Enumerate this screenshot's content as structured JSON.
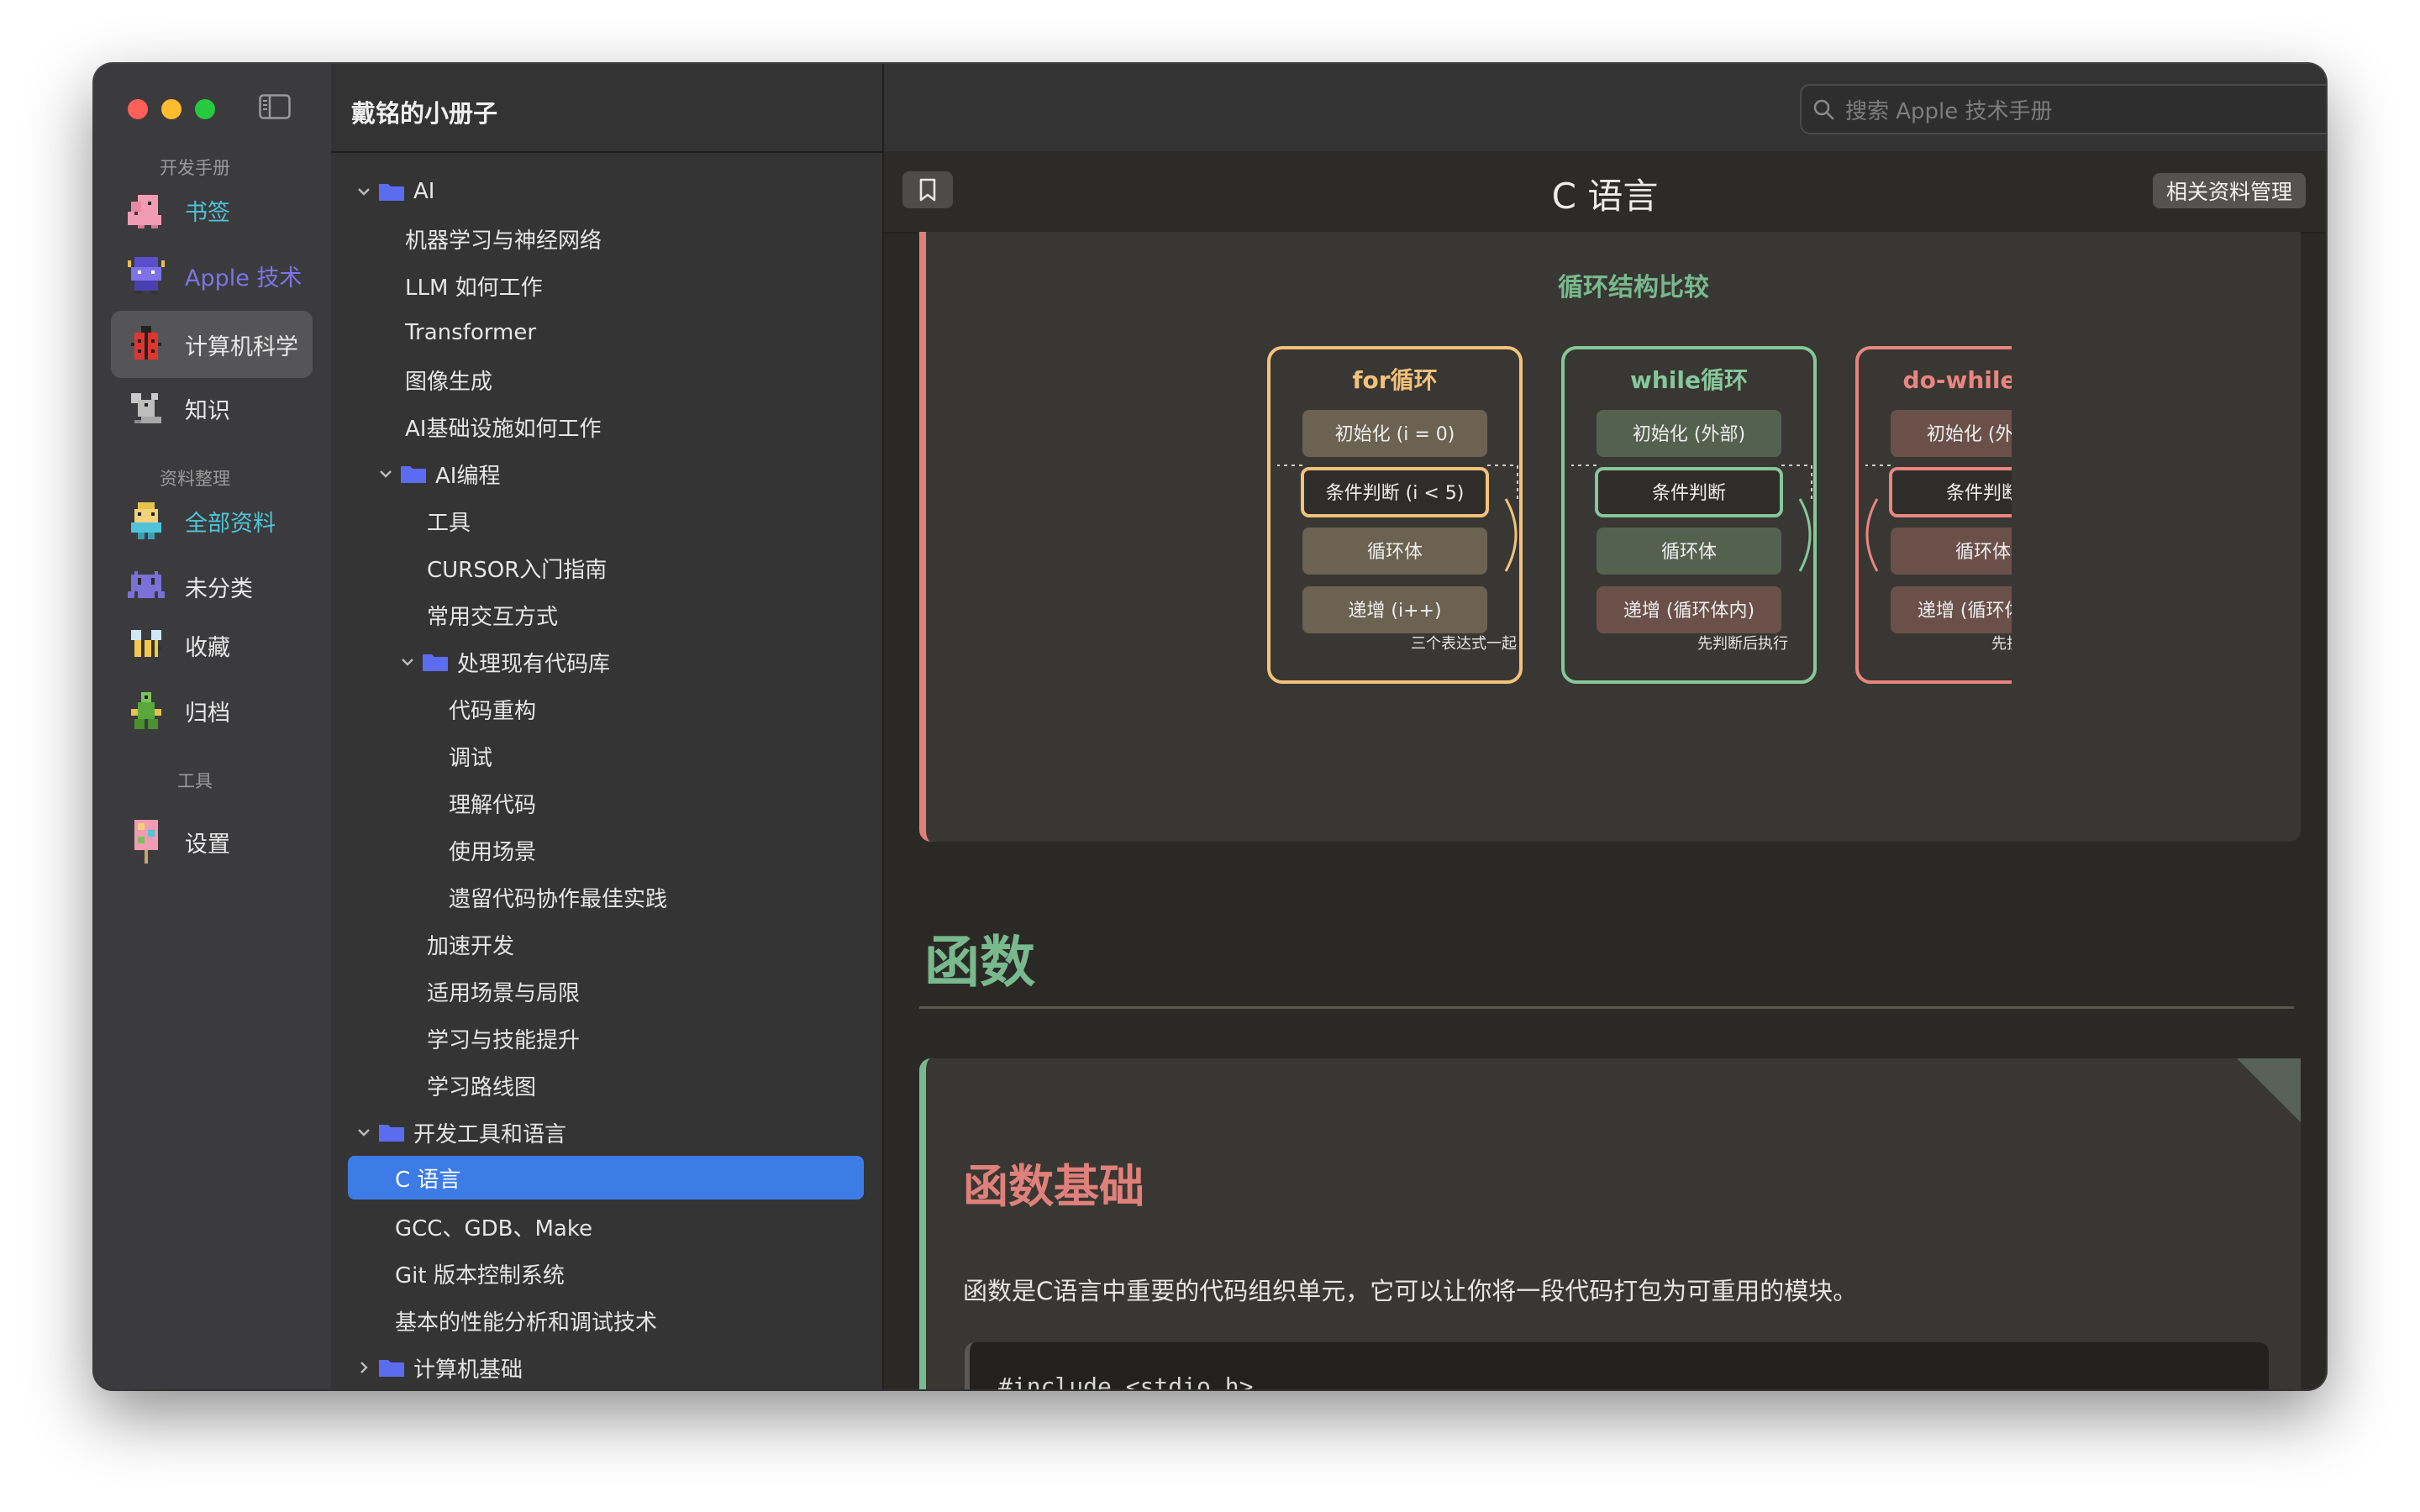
{
  "app": {
    "title": "戴铭的小册子",
    "search_placeholder": "搜索 Apple 技术手册"
  },
  "sidebar": {
    "sections": [
      {
        "label": "开发手册"
      },
      {
        "label": "资料整理"
      },
      {
        "label": "工具"
      }
    ],
    "items": [
      {
        "label": "书签",
        "color": "#4fc3d9",
        "icon": "pixel-elephant-icon"
      },
      {
        "label": "Apple 技术",
        "color": "#7d73e6",
        "icon": "pixel-character-icon"
      },
      {
        "label": "计算机科学",
        "color": "#e8e8e8",
        "icon": "pixel-ladybug-icon",
        "selected": true
      },
      {
        "label": "知识",
        "color": "#e8e8e8",
        "icon": "pixel-mouse-icon"
      },
      {
        "label": "全部资料",
        "color": "#4fc3d9",
        "icon": "pixel-robot-icon"
      },
      {
        "label": "未分类",
        "color": "#e8e8e8",
        "icon": "pixel-invader-icon"
      },
      {
        "label": "收藏",
        "color": "#e8e8e8",
        "icon": "pixel-bee-icon"
      },
      {
        "label": "归档",
        "color": "#e8e8e8",
        "icon": "pixel-frog-icon"
      },
      {
        "label": "设置",
        "color": "#e8e8e8",
        "icon": "pixel-popsicle-icon"
      }
    ]
  },
  "tree": [
    {
      "label": "AI",
      "level": 0,
      "folder": true,
      "expanded": true
    },
    {
      "label": "机器学习与神经网络",
      "level": 1
    },
    {
      "label": "LLM 如何工作",
      "level": 1
    },
    {
      "label": "Transformer",
      "level": 1
    },
    {
      "label": "图像生成",
      "level": 1
    },
    {
      "label": "AI基础设施如何工作",
      "level": 1
    },
    {
      "label": "AI编程",
      "level": 1,
      "folder": true,
      "expanded": true
    },
    {
      "label": "工具",
      "level": 2
    },
    {
      "label": "CURSOR入门指南",
      "level": 2
    },
    {
      "label": "常用交互方式",
      "level": 2
    },
    {
      "label": "处理现有代码库",
      "level": 2,
      "folder": true,
      "expanded": true
    },
    {
      "label": "代码重构",
      "level": 3
    },
    {
      "label": "调试",
      "level": 3
    },
    {
      "label": "理解代码",
      "level": 3
    },
    {
      "label": "使用场景",
      "level": 3
    },
    {
      "label": "遗留代码协作最佳实践",
      "level": 3
    },
    {
      "label": "加速开发",
      "level": 2
    },
    {
      "label": "适用场景与局限",
      "level": 2
    },
    {
      "label": "学习与技能提升",
      "level": 2
    },
    {
      "label": "学习路线图",
      "level": 2
    },
    {
      "label": "开发工具和语言",
      "level": 0,
      "folder": true,
      "expanded": true
    },
    {
      "label": "C 语言",
      "level": 1,
      "selected": true
    },
    {
      "label": "GCC、GDB、Make",
      "level": 1
    },
    {
      "label": "Git 版本控制系统",
      "level": 1
    },
    {
      "label": "基本的性能分析和调试技术",
      "level": 1
    },
    {
      "label": "计算机基础",
      "level": 0,
      "folder": true,
      "expanded": false
    }
  ],
  "doc": {
    "title": "C 语言",
    "related_button": "相关资料管理",
    "diagram": {
      "title": "循环结构比较",
      "loops": [
        {
          "name": "for循环",
          "color": "#f2c27a",
          "steps": [
            "初始化 (i = 0)",
            "条件判断 (i < 5)",
            "循环体",
            "递增 (i++)"
          ],
          "note": "三个表达式一起"
        },
        {
          "name": "while循环",
          "color": "#86c79a",
          "steps": [
            "初始化 (外部)",
            "条件判断",
            "循环体",
            "递增 (循环体内)"
          ],
          "note": "先判断后执行"
        },
        {
          "name": "do-while循环",
          "color": "#e8867f",
          "steps": [
            "初始化 (外部)",
            "条件判断",
            "循环体",
            "递增 (循环体内)"
          ],
          "note": "先执行后判断"
        }
      ]
    },
    "section_heading": "函数",
    "card": {
      "subheading": "函数基础",
      "paragraph": "函数是C语言中重要的代码组织单元，它可以让你将一段代码打包为可重用的模块。",
      "code_first_line": "#include <stdio.h>"
    }
  }
}
